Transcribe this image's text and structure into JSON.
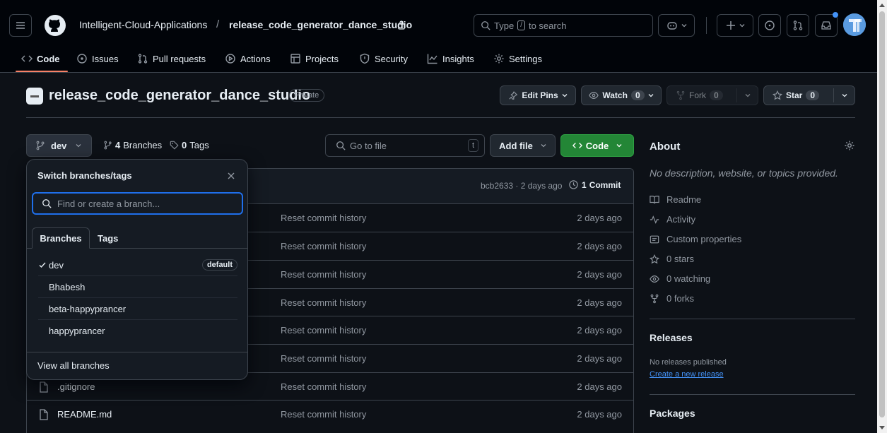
{
  "header": {
    "owner": "Intelligent-Cloud-Applications",
    "separator": "/",
    "repo": "release_code_generator_dance_studio",
    "search_prefix": "Type",
    "search_key": "/",
    "search_suffix": "to search"
  },
  "nav_tabs": [
    {
      "label": "Code",
      "icon": "code-icon"
    },
    {
      "label": "Issues",
      "icon": "issue-icon"
    },
    {
      "label": "Pull requests",
      "icon": "pull-request-icon"
    },
    {
      "label": "Actions",
      "icon": "play-icon"
    },
    {
      "label": "Projects",
      "icon": "table-icon"
    },
    {
      "label": "Security",
      "icon": "shield-icon"
    },
    {
      "label": "Insights",
      "icon": "graph-icon"
    },
    {
      "label": "Settings",
      "icon": "gear-icon"
    }
  ],
  "repo_header": {
    "name": "release_code_generator_dance_studio",
    "visibility": "Private",
    "edit_pins": "Edit Pins",
    "watch": "Watch",
    "watch_count": "0",
    "fork": "Fork",
    "fork_count": "0",
    "star": "Star",
    "star_count": "0"
  },
  "toolbar": {
    "branch": "dev",
    "branches_count": "4",
    "branches_label": "Branches",
    "tags_count": "0",
    "tags_label": "Tags",
    "go_to_file": "Go to file",
    "go_to_file_key": "t",
    "add_file": "Add file",
    "code": "Code"
  },
  "commit_bar": {
    "hash_meta": "bcb2633 · 2 days ago",
    "commits_count": "1",
    "commits_label": "Commit"
  },
  "files": [
    {
      "name": "",
      "message": "Reset commit history",
      "date": "2 days ago"
    },
    {
      "name": "",
      "message": "Reset commit history",
      "date": "2 days ago"
    },
    {
      "name": "",
      "message": "Reset commit history",
      "date": "2 days ago"
    },
    {
      "name": "",
      "message": "Reset commit history",
      "date": "2 days ago"
    },
    {
      "name": "",
      "message": "Reset commit history",
      "date": "2 days ago"
    },
    {
      "name": "",
      "message": "Reset commit history",
      "date": "2 days ago"
    },
    {
      "name": ".gitignore",
      "message": "Reset commit history",
      "date": "2 days ago"
    },
    {
      "name": "README.md",
      "message": "Reset commit history",
      "date": "2 days ago"
    }
  ],
  "branch_dropdown": {
    "title": "Switch branches/tags",
    "placeholder": "Find or create a branch...",
    "tab_branches": "Branches",
    "tab_tags": "Tags",
    "branches": [
      {
        "name": "dev",
        "selected": true,
        "badge": "default"
      },
      {
        "name": "Bhabesh",
        "selected": false,
        "badge": ""
      },
      {
        "name": "beta-happyprancer",
        "selected": false,
        "badge": ""
      },
      {
        "name": "happyprancer",
        "selected": false,
        "badge": ""
      }
    ],
    "view_all": "View all branches"
  },
  "about": {
    "title": "About",
    "description": "No description, website, or topics provided.",
    "readme": "Readme",
    "activity": "Activity",
    "custom_properties": "Custom properties",
    "stars": "0 stars",
    "watching": "0 watching",
    "forks": "0 forks",
    "releases_title": "Releases",
    "no_releases": "No releases published",
    "create_release": "Create a new release",
    "packages_title": "Packages"
  },
  "colors": {
    "background": "#0d1117",
    "header_bg": "#010409",
    "accent_green": "#238636",
    "link_blue": "#4493f8",
    "border": "#3d444d",
    "focus_ring": "#1f6feb"
  }
}
